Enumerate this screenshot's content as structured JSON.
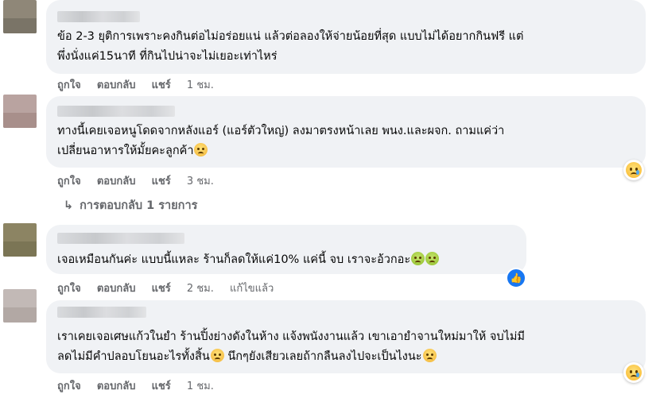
{
  "colors": {
    "bubble": "#f0f2f5",
    "meta_text": "#65676b",
    "like_blue": "#1877f2"
  },
  "comments": [
    {
      "line1": "ข้อ 2-3 ยุติการเพราะคงกินต่อไม่อร่อยแน่ แล้วต่อลองให้จ่ายน้อยที่สุด แบบไม่ได้อยากกินฟรี แต่",
      "line2": "พึ่งนั่งแค่15นาที ที่กินไปน่าจะไม่เยอะเท่าไหร่",
      "like": "ถูกใจ",
      "reply": "ตอบกลับ",
      "share": "แชร์",
      "time": "1 ชม."
    },
    {
      "line1": "ทางนี้เคยเจอหนูโดดจากหลังแอร์ (แอร์ตัวใหญ่) ลงมาตรงหน้าเลย พนง.และผจก. ถามแค่ว่า",
      "line2": "เปลี่ยนอาหารให้มั้ยคะลูกค้า",
      "like": "ถูกใจ",
      "reply": "ตอบกลับ",
      "share": "แชร์",
      "time": "3 ชม.",
      "replies_label": "การตอบกลับ 1 รายการ"
    },
    {
      "line1": "เจอเหมือนกันค่ะ แบบนี้แหละ ร้านก็ลดให้แค่10% แค่นี้ จบ เราจะอ้วกอะ",
      "like": "ถูกใจ",
      "reply": "ตอบกลับ",
      "share": "แชร์",
      "time": "2 ชม.",
      "edited": "แก้ไขแล้ว"
    },
    {
      "line1": "เราเคยเจอเศษแก้วในยำ ร้านปิ้งย่างดังในห้าง แจ้งพนังงานแล้ว เขาเอายำจานใหม่มาให้ จบไม่มี",
      "line2a": "ลดไม่มีคำปลอบโยนอะไรทั้งสิ้น",
      "line2b": " นึกๆยังเสียวเลยถ้ากลืนลงไปจะเป็นไงนะ",
      "like": "ถูกใจ",
      "reply": "ตอบกลับ",
      "share": "แชร์",
      "time": "1 ชม."
    }
  ],
  "icons": {
    "reaction_sad": "sad-face-icon",
    "reaction_like": "like-thumb-icon",
    "reply_arrow": "reply-arrow-icon"
  }
}
